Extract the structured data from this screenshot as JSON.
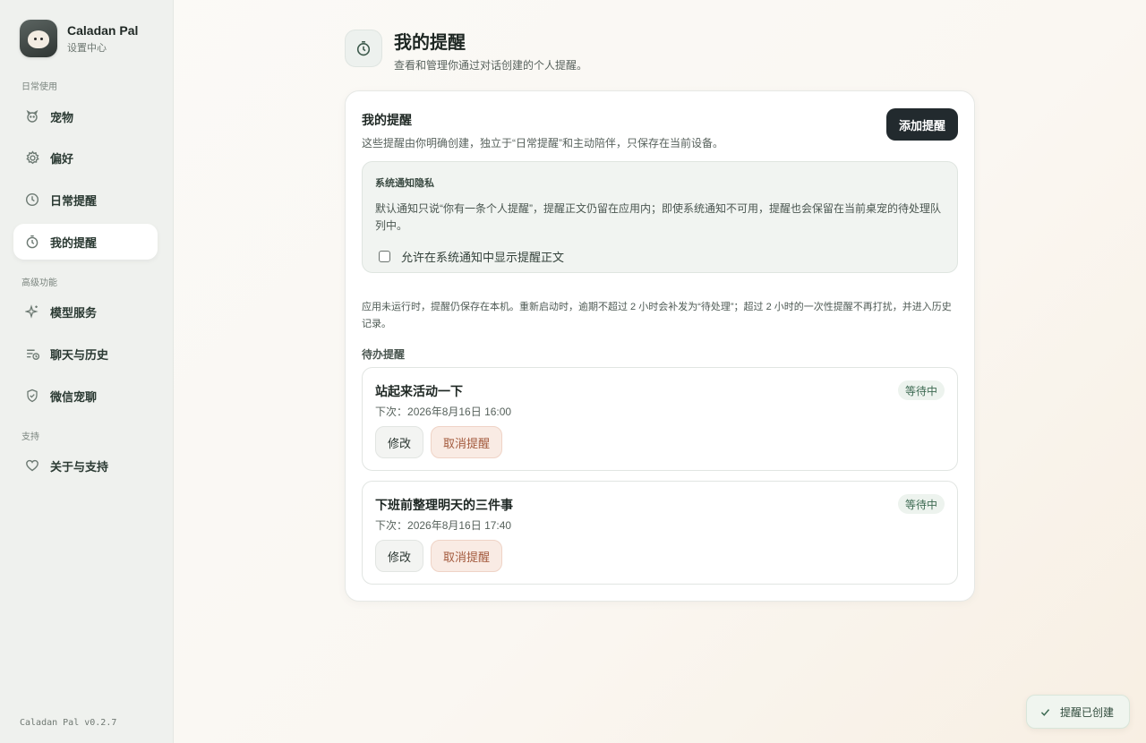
{
  "brand": {
    "name": "Caladan Pal",
    "subtitle": "设置中心"
  },
  "sidebar": {
    "sections": [
      {
        "label": "日常使用"
      },
      {
        "label": "高级功能"
      },
      {
        "label": "支持"
      }
    ],
    "items": [
      {
        "label": "宠物",
        "icon": "pet-icon"
      },
      {
        "label": "偏好",
        "icon": "gear-icon"
      },
      {
        "label": "日常提醒",
        "icon": "clock-icon"
      },
      {
        "label": "我的提醒",
        "icon": "timer-icon",
        "active": true
      },
      {
        "label": "模型服务",
        "icon": "sparkle-icon"
      },
      {
        "label": "聊天与历史",
        "icon": "chat-history-icon"
      },
      {
        "label": "微信宠聊",
        "icon": "shield-check-icon"
      },
      {
        "label": "关于与支持",
        "icon": "heart-icon"
      }
    ],
    "version": "Caladan Pal v0.2.7"
  },
  "header": {
    "title": "我的提醒",
    "subtitle": "查看和管理你通过对话创建的个人提醒。"
  },
  "card": {
    "title": "我的提醒",
    "description": "这些提醒由你明确创建，独立于“日常提醒”和主动陪伴，只保存在当前设备。",
    "add_button": "添加提醒",
    "privacy": {
      "title": "系统通知隐私",
      "body": "默认通知只说“你有一条个人提醒”，提醒正文仍留在应用内；即使系统通知不可用，提醒也会保留在当前桌宠的待处理队列中。",
      "checkbox_label": "允许在系统通知中显示提醒正文",
      "checked": false
    },
    "note": "应用未运行时，提醒仍保存在本机。重新启动时，逾期不超过 2 小时会补发为“待处理”；超过 2 小时的一次性提醒不再打扰，并进入历史记录。",
    "pending_label": "待办提醒",
    "reminders": [
      {
        "title": "站起来活动一下",
        "next_prefix": "下次：",
        "next_time": "2026年8月16日 16:00",
        "status": "等待中",
        "edit": "修改",
        "cancel": "取消提醒"
      },
      {
        "title": "下班前整理明天的三件事",
        "next_prefix": "下次：",
        "next_time": "2026年8月16日 17:40",
        "status": "等待中",
        "edit": "修改",
        "cancel": "取消提醒"
      }
    ]
  },
  "toast": {
    "text": "提醒已创建",
    "icon": "check-icon"
  }
}
